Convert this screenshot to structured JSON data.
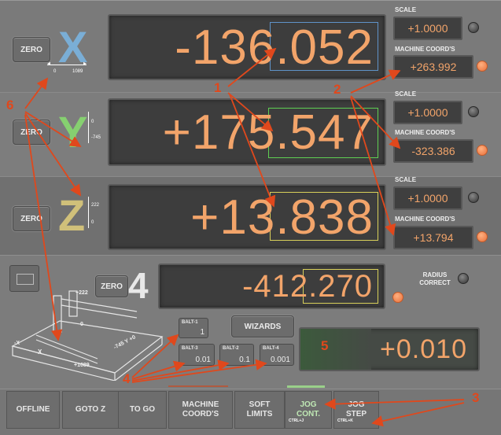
{
  "zero_label": "ZERO",
  "axes": {
    "x": {
      "letter": "X",
      "value": "-136.052",
      "color": "#7aaed6",
      "hl_color": "#5f93c9",
      "tick_min": "0",
      "tick_max": "1089",
      "scale": "+1.0000",
      "machine": "+263.992"
    },
    "y": {
      "letter": "Y",
      "value": "+175.547",
      "color": "#86d070",
      "hl_color": "#5fcf52",
      "tick_min": "0",
      "tick_max": "-745",
      "scale": "+1.0000",
      "machine": "-323.386"
    },
    "z": {
      "letter": "Z",
      "value": "+13.838",
      "color": "#d0c07a",
      "hl_color": "#d8d05a",
      "tick_min": "222",
      "tick_max": "0",
      "scale": "+1.0000",
      "machine": "+13.794"
    },
    "a": {
      "letter": "4",
      "value": "-412.270",
      "hl_color": "#d8d05a"
    }
  },
  "labels": {
    "scale": "SCALE",
    "machine": "MACHINE COORD'S",
    "radius_correct": "RADIUS CORRECT"
  },
  "jog": {
    "balt1": "BALT-1",
    "balt1_val": "1",
    "balt3": "BALT-3",
    "balt3_val": "0.01",
    "balt2": "BALT-2",
    "balt2_val": "0.1",
    "balt4": "BALT-4",
    "balt4_val": "0.001",
    "wizards": "WIZARDS",
    "feed_value": "+0.010"
  },
  "machine_image": {
    "z_top": "+222",
    "z_bot": "0",
    "x_left": "-X",
    "x_right": "+1089",
    "y_label": "-745  Y  +0"
  },
  "toolbar": [
    {
      "label": "OFFLINE",
      "sub": ""
    },
    {
      "label": "GOTO Z",
      "sub": ""
    },
    {
      "label": "TO GO",
      "sub": ""
    },
    {
      "label": "MACHINE COORD'S",
      "sub": ""
    },
    {
      "label": "SOFT LIMITS",
      "sub": ""
    },
    {
      "label": "JOG CONT.",
      "sub": "CTRL+J"
    },
    {
      "label": "JOG STEP",
      "sub": "CTRL+K"
    }
  ],
  "annotations": {
    "a1": "1",
    "a2": "2",
    "a3": "3",
    "a4": "4",
    "a5": "5",
    "a6": "6"
  },
  "colors": {
    "annotation": "#e0481c",
    "dro_text": "#f2a46a"
  }
}
